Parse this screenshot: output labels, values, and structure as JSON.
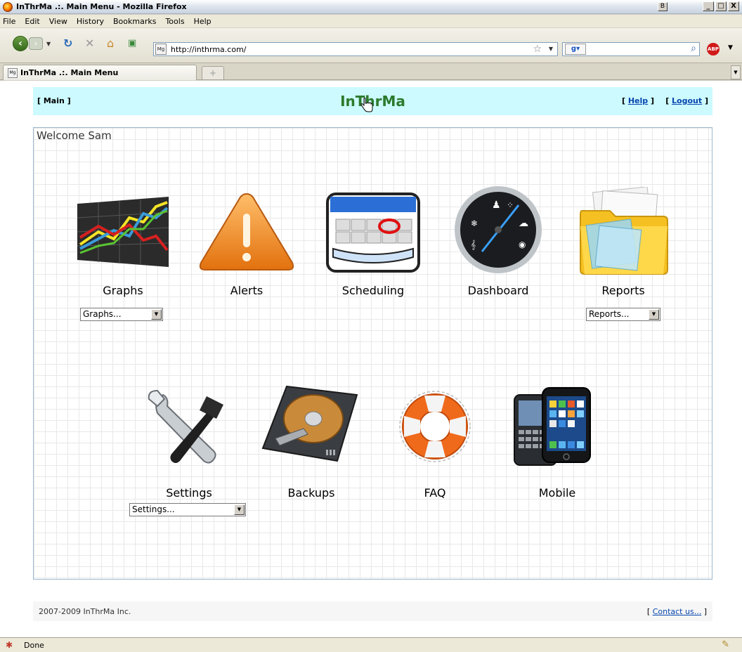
{
  "window": {
    "title": "InThrMa .:. Main Menu - Mozilla Firefox",
    "minimize": "_",
    "maximize": "□",
    "close": "X"
  },
  "menubar": [
    "File",
    "Edit",
    "View",
    "History",
    "Bookmarks",
    "Tools",
    "Help"
  ],
  "navbar": {
    "url": "http://inthrma.com/",
    "search_placeholder": ""
  },
  "tabs": [
    {
      "label": "InThrMa .:. Main Menu"
    }
  ],
  "page": {
    "header": {
      "main_link": "[ Main ]",
      "brand": "InThrMa",
      "help_bracket_open": "[ ",
      "help_link": "Help",
      "help_bracket_close": " ]",
      "logout_bracket_open": "[ ",
      "logout_link": "Logout",
      "logout_bracket_close": " ]"
    },
    "welcome": "Welcome Sam",
    "tiles": [
      {
        "label": "Graphs",
        "icon": "graph-chart-icon",
        "dropdown": "Graphs..."
      },
      {
        "label": "Alerts",
        "icon": "warning-triangle-icon"
      },
      {
        "label": "Scheduling",
        "icon": "calendar-icon"
      },
      {
        "label": "Dashboard",
        "icon": "gauge-icon"
      },
      {
        "label": "Reports",
        "icon": "folder-documents-icon",
        "dropdown": "Reports..."
      },
      {
        "label": "Settings",
        "icon": "wrench-hammer-icon",
        "dropdown": "Settings..."
      },
      {
        "label": "Backups",
        "icon": "hard-drive-icon"
      },
      {
        "label": "FAQ",
        "icon": "lifebuoy-icon"
      },
      {
        "label": "Mobile",
        "icon": "smartphones-icon"
      }
    ],
    "footer": {
      "copyright": "2007-2009 InThrMa Inc.",
      "contact_bracket_open": "[ ",
      "contact_link": "Contact us...",
      "contact_bracket_close": " ]"
    }
  },
  "statusbar": {
    "text": "Done"
  }
}
